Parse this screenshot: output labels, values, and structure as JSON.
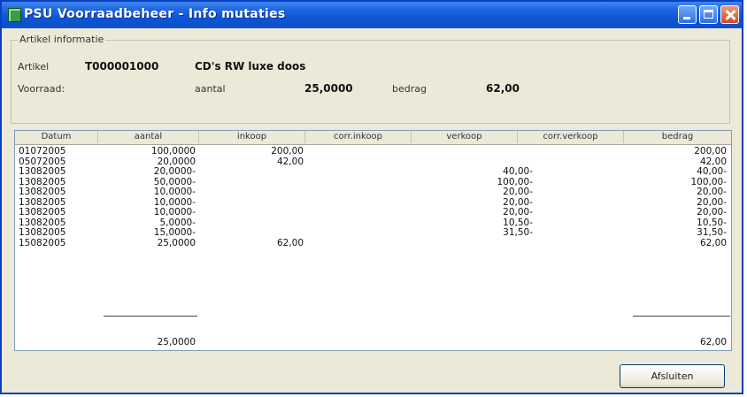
{
  "window": {
    "title": "PSU Voorraadbeheer - Info mutaties",
    "app_icon": "app-icon",
    "title_buttons": [
      "minimize-icon",
      "maximize-icon",
      "close-icon"
    ]
  },
  "artikel": {
    "group_title": "Artikel informatie",
    "artikel_label": "Artikel",
    "artikel_code": "T000001000",
    "artikel_desc": "CD's RW luxe doos",
    "voorraad_label": "Voorraad:",
    "aantal_label": "aantal",
    "aantal_value": "25,0000",
    "bedrag_label": "bedrag",
    "bedrag_value": "62,00"
  },
  "table": {
    "columns": [
      "Datum",
      "aantal",
      "inkoop",
      "corr.inkoop",
      "verkoop",
      "corr.verkoop",
      "bedrag"
    ],
    "rows": [
      [
        "01072005",
        "100,0000",
        "200,00",
        "",
        "",
        "",
        "200,00"
      ],
      [
        "05072005",
        "20,0000",
        "42,00",
        "",
        "",
        "",
        "42,00"
      ],
      [
        "13082005",
        "20,0000-",
        "",
        "",
        "40,00-",
        "",
        "40,00-"
      ],
      [
        "13082005",
        "50,0000-",
        "",
        "",
        "100,00-",
        "",
        "100,00-"
      ],
      [
        "13082005",
        "10,0000-",
        "",
        "",
        "20,00-",
        "",
        "20,00-"
      ],
      [
        "13082005",
        "10,0000-",
        "",
        "",
        "20,00-",
        "",
        "20,00-"
      ],
      [
        "13082005",
        "10,0000-",
        "",
        "",
        "20,00-",
        "",
        "20,00-"
      ],
      [
        "13082005",
        "5,0000-",
        "",
        "",
        "10,50-",
        "",
        "10,50-"
      ],
      [
        "13082005",
        "15,0000-",
        "",
        "",
        "31,50-",
        "",
        "31,50-"
      ],
      [
        "15082005",
        "25,0000",
        "62,00",
        "",
        "",
        "",
        "62,00"
      ]
    ],
    "totals": {
      "aantal": "25,0000",
      "bedrag": "62,00"
    }
  },
  "buttons": {
    "close_label": "Afsluiten"
  }
}
